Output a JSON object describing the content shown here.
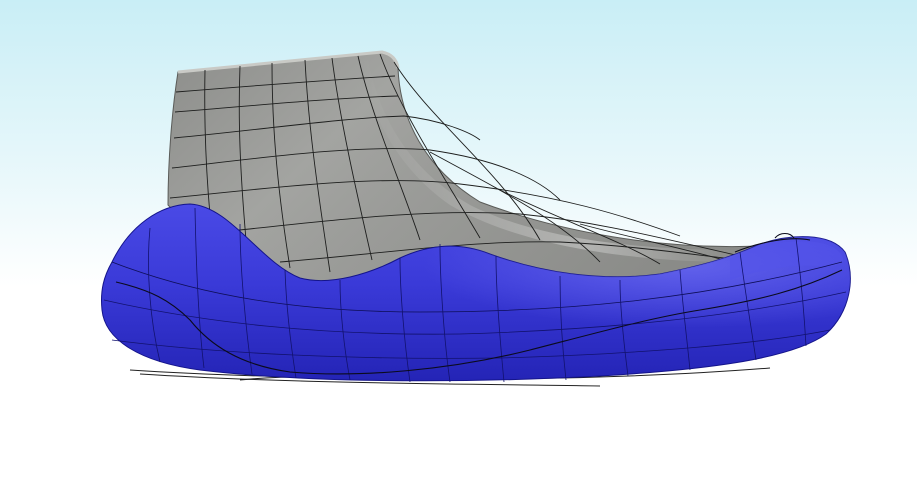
{
  "viewport": {
    "background_top": "#c9eef6",
    "background_bottom": "#ffffff"
  },
  "model": {
    "upper_color": "#999a97",
    "upper_highlight": "#d7d8d4",
    "upper_shadow": "#6c6e6b",
    "sole_color": "#3a3ad8",
    "sole_highlight": "#6464f0",
    "sole_shadow": "#1c1ca4",
    "wire_color": "#1e1f1e"
  }
}
